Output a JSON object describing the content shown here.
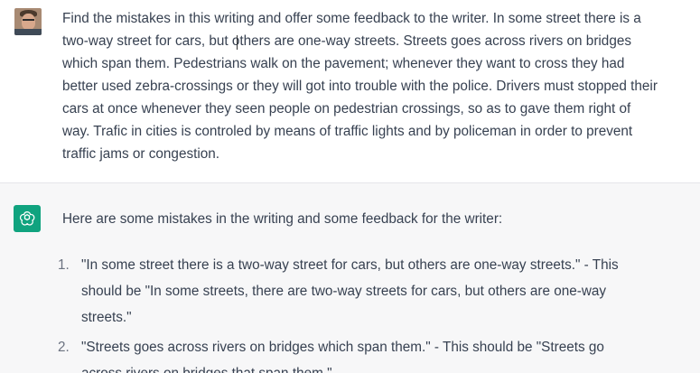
{
  "user_message": {
    "text": "Find the mistakes in this writing and offer some feedback to the writer. In some street there is a two-way street for cars, but others are one-way streets. Streets goes across rivers on bridges which span them. Pedestrians walk on the pavement; whenever they want to cross they had better used zebra-crossings or they will got into trouble with the police. Drivers must stopped their cars at once whenever they seen people on pedestrian crossings, so as to gave them right of way. Trafic in cities is controled by means of traffic lights and by policeman in order to prevent traffic jams or congestion."
  },
  "assistant_message": {
    "intro": "Here are some mistakes in the writing and some feedback for the writer:",
    "items": [
      {
        "number": "1.",
        "text": "\"In some street there is a two-way street for cars, but others are one-way streets.\" - This should be \"In some streets, there are two-way streets for cars, but others are one-way streets.\""
      },
      {
        "number": "2.",
        "text": "\"Streets goes across rivers on bridges which span them.\" - This should be \"Streets go across rivers on bridges that span them.\""
      }
    ]
  },
  "colors": {
    "assistant_bg": "#f7f7f8",
    "brand_green": "#10a37f",
    "text": "#374151"
  },
  "icons": {
    "user_avatar": "user-avatar-photo",
    "assistant_avatar": "openai-logo-icon"
  }
}
